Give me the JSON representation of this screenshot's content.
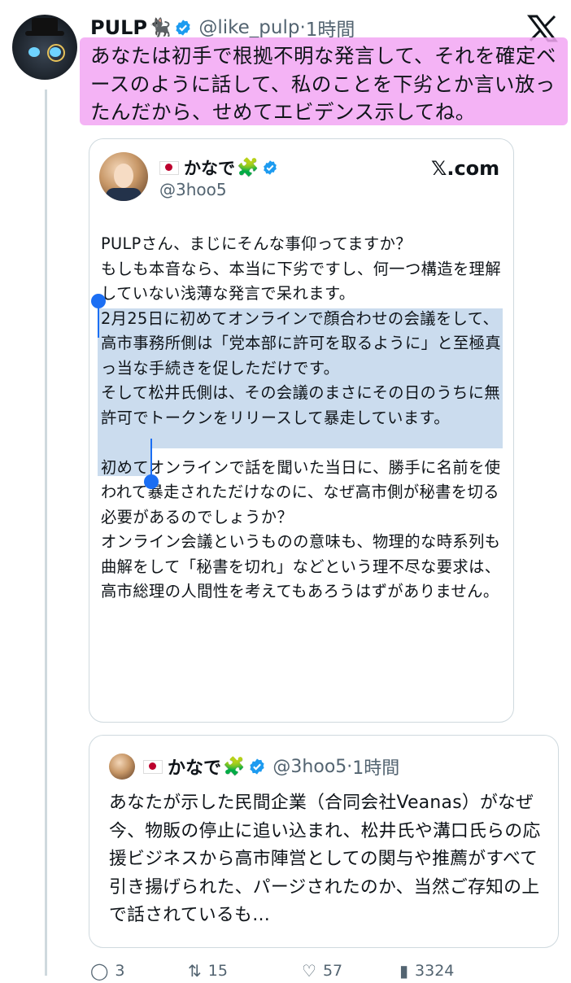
{
  "tweet": {
    "author_name": "PULP",
    "author_emoji": "🐈‍⬛",
    "handle": "@like_pulp",
    "separator": "·",
    "time": "1時間",
    "text": "あなたは初手で根拠不明な発言して、それを確定ベースのように話して、私のことを下劣とか言い放ったんだから、せめてエビデンス示してね。"
  },
  "quote": {
    "name": "かなで",
    "handle": "@3hoo5",
    "source": "𝕏.com",
    "body": "PULPさん、まじにそんな事仰ってますか？\nもしも本音なら、本当に下劣ですし、何一つ構造を理解していない浅薄な発言で呆れます。\n2月25日に初めてオンラインで顔合わせの会議をして、高市事務所側は「党本部に許可を取るように」と至極真っ当な手続きを促しただけです。\nそして松井氏側は、その会議のまさにその日のうちに無許可でトークンをリリースして暴走しています。\n\n初めてオンラインで話を聞いた当日に、勝手に名前を使われて暴走されただけなのに、なぜ高市側が秘書を切る必要があるのでしょうか？\nオンライン会議というものの意味も、物理的な時系列も曲解をして「秘書を切れ」などという理不尽な要求は、高市総理の人間性を考えてもあろうはずがありません。"
  },
  "nested_quote": {
    "name": "かなで",
    "handle": "@3hoo5",
    "separator": "·",
    "time": "1時間",
    "body": "あなたが示した民間企業（合同会社Veanas）がなぜ今、物販の停止に追い込まれ、松井氏や溝口氏らの応援ビジネスから高市陣営としての関与や推薦がすべて引き揚げられた、パージされたのか、当然ご存知の上で話されているも…"
  },
  "actions": {
    "replies": "3",
    "reposts": "15",
    "likes": "57",
    "views": "3324"
  },
  "colors": {
    "highlight": "#f2a6f3",
    "selection": "#cbdcee",
    "selection_handle": "#1b6ef3",
    "verified": "#1d9bf0"
  },
  "icons": [
    "x-logo-icon",
    "verified-icon",
    "japan-flag-icon",
    "puzzle-icon",
    "reply-icon",
    "repost-icon",
    "like-icon",
    "views-icon"
  ]
}
